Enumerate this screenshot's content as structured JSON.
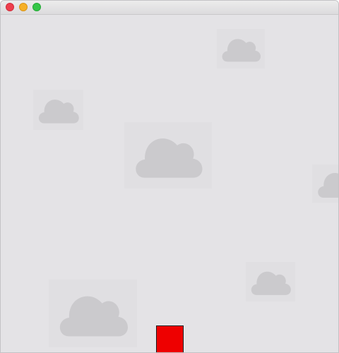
{
  "window": {
    "controls": [
      {
        "name": "close-button",
        "color": "#ee3f4d",
        "border": "#d12d3b"
      },
      {
        "name": "minimize-button",
        "color": "#f6b026",
        "border": "#d99518"
      },
      {
        "name": "maximize-button",
        "color": "#35c648",
        "border": "#23a835"
      }
    ]
  },
  "game": {
    "background_color": "#e4e3e6",
    "cloud_color": "#cbcacd",
    "clouds": [
      {
        "id": "cloud-1",
        "icon": "cloud-icon"
      },
      {
        "id": "cloud-2",
        "icon": "cloud-icon"
      },
      {
        "id": "cloud-3",
        "icon": "cloud-icon"
      },
      {
        "id": "cloud-4",
        "icon": "cloud-icon"
      },
      {
        "id": "cloud-5",
        "icon": "cloud-icon"
      },
      {
        "id": "cloud-6",
        "icon": "cloud-icon"
      }
    ],
    "player": {
      "shape": "square",
      "color": "#ee0000"
    }
  }
}
